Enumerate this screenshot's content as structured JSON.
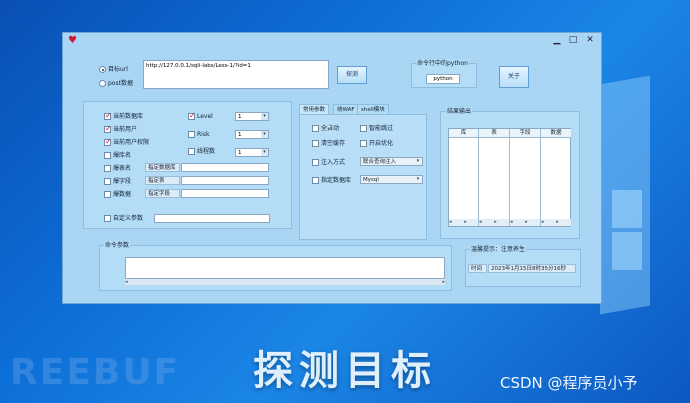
{
  "desktop_overlay": {
    "caption": "探测目标",
    "watermark": "REEBUF",
    "credit": "CSDN @程序员小予"
  },
  "window": {
    "controls": {
      "minimize": "▁",
      "maximize": "□",
      "close": "✕"
    }
  },
  "target": {
    "radio_url": "目标url",
    "radio_post": "post数据",
    "url_value": "http://127.0.0.1/sqli-labs/Less-1/?id=1",
    "probe_button": "探测"
  },
  "python_box": {
    "title": "命令行中的python",
    "value": "python",
    "about_button": "关于"
  },
  "options": {
    "current_db": "当前数据库",
    "current_user": "当前用户",
    "current_user_priv": "当前用户权限",
    "dump_dbnames": "爆库名",
    "dump_tables": "爆表名",
    "dump_columns": "爆字段",
    "dump_data": "爆数据",
    "specify_db": "指定数据库",
    "specify_table": "指定表",
    "specify_column": "指定字段",
    "custom_params": "自定义参数",
    "level_label": "Level",
    "level_value": "1",
    "risk_label": "Risk",
    "risk_value": "1",
    "threads_label": "线程数",
    "threads_value": "1"
  },
  "tabs": {
    "items": [
      "常用参数",
      "绕WAF",
      "shell模块"
    ],
    "active": 0
  },
  "common_params": {
    "auto": "全自动",
    "smart_skip": "智能跳过",
    "clear_cache": "清空缓存",
    "enable_opt": "开启优化",
    "inject_method": "注入方式",
    "inject_value": "联合查询注入",
    "specify_dbms": "指定数据库",
    "dbms_value": "Mysql"
  },
  "results": {
    "title": "结果输出",
    "columns": [
      "库",
      "表",
      "字段",
      "数据"
    ]
  },
  "command": {
    "title": "命令参数"
  },
  "tips": {
    "title": "温馨提示：注意养生",
    "time_label": "时间",
    "time_value": "2023年1月15日8时35分16秒"
  }
}
